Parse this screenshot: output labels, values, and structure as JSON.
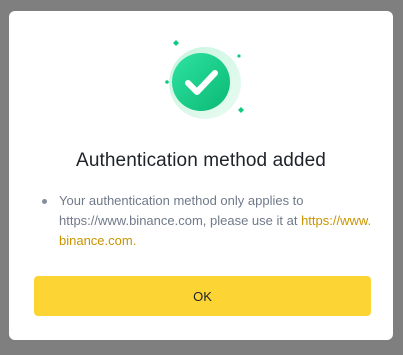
{
  "dialog": {
    "title": "Authentication method added",
    "notice_text": "Your authentication method only applies to https://www.binance.com, please use it at ",
    "notice_link": "https://www.binance.com.",
    "ok_label": "OK"
  },
  "colors": {
    "accent_green": "#0ecb81",
    "button_yellow": "#fcd535",
    "link_gold": "#c99400"
  }
}
